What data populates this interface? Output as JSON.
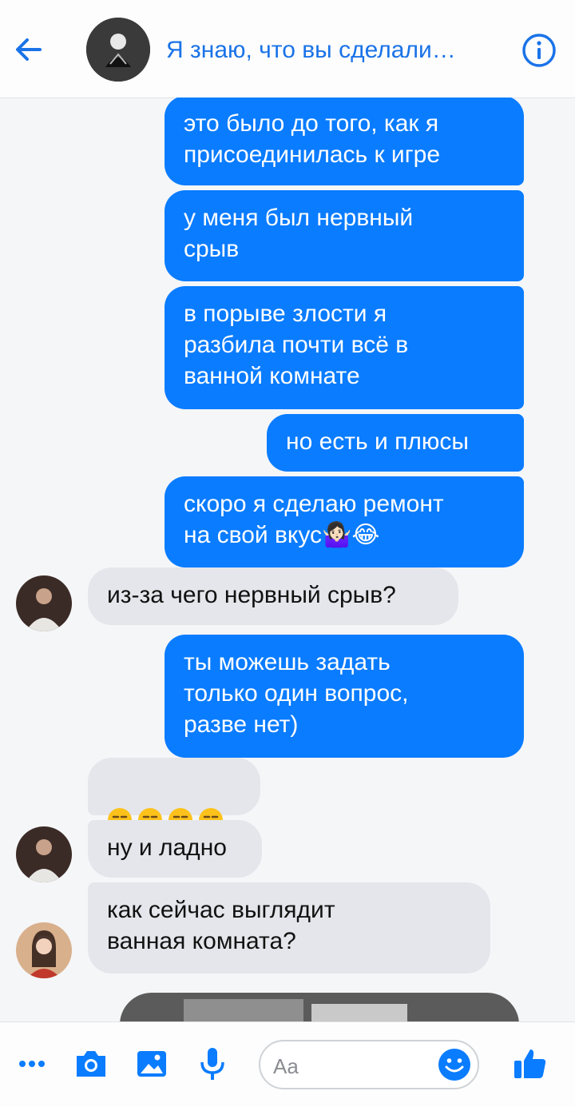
{
  "header": {
    "title": "Я знаю, что вы сделали…",
    "back_icon": "arrow-left-icon",
    "info_icon": "info-icon",
    "accent": "#1a73e8"
  },
  "messages": [
    {
      "side": "out",
      "text": "это было до того, как я\nприсоединилась к игре"
    },
    {
      "side": "out",
      "text": "у меня был нервный\nсрыв"
    },
    {
      "side": "out",
      "text": "в порыве злости я\nразбила почти всё в\nванной комнате"
    },
    {
      "side": "out",
      "text": "но есть и плюсы"
    },
    {
      "side": "out",
      "text": "скоро я сделаю ремонт\nна свой вкус🤷🏻‍♀️😂"
    },
    {
      "side": "in",
      "text": "из-за чего нервный срыв?"
    },
    {
      "side": "out",
      "text": "ты можешь задать\nтолько один вопрос,\nразве нет)"
    },
    {
      "side": "in",
      "emoji": "😒😒😒😒"
    },
    {
      "side": "in",
      "text": "ну и ладно"
    },
    {
      "side": "in",
      "text": "как сейчас выглядит\nванная комната?"
    }
  ],
  "composer": {
    "placeholder": "Aa",
    "icons": [
      "more-icon",
      "camera-icon",
      "image-icon",
      "microphone-icon",
      "emoji-icon",
      "thumbs-up-icon"
    ]
  },
  "colors": {
    "outgoing_bubble": "#0a7cff",
    "incoming_bubble": "#e4e6eb",
    "background": "#f5f6f8"
  }
}
